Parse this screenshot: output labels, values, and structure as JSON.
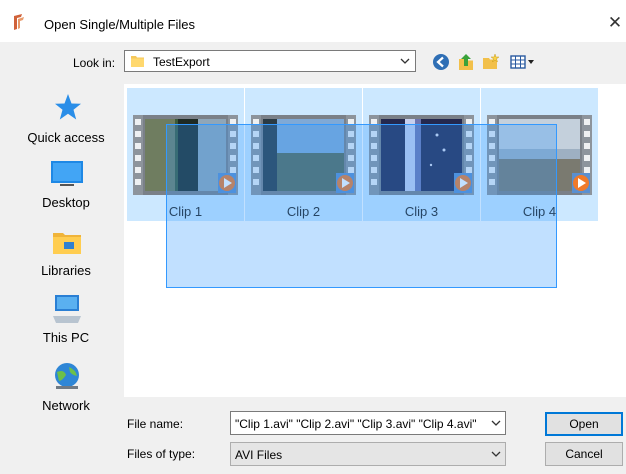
{
  "window": {
    "title": "Open Single/Multiple Files",
    "close_glyph": "✕"
  },
  "toolbar": {
    "look_in_label": "Look in:",
    "look_in_value": "TestExport",
    "icons": [
      "back-icon",
      "up-folder-icon",
      "new-folder-icon",
      "view-menu-icon"
    ]
  },
  "places": [
    {
      "label": "Quick access",
      "icon": "quick-access-star-icon"
    },
    {
      "label": "Desktop",
      "icon": "desktop-icon"
    },
    {
      "label": "Libraries",
      "icon": "libraries-icon"
    },
    {
      "label": "This PC",
      "icon": "this-pc-icon"
    },
    {
      "label": "Network",
      "icon": "network-icon"
    }
  ],
  "files": [
    {
      "name": "Clip 1",
      "selected": true
    },
    {
      "name": "Clip 2",
      "selected": true
    },
    {
      "name": "Clip 3",
      "selected": true
    },
    {
      "name": "Clip 4",
      "selected": true
    }
  ],
  "form": {
    "file_name_label": "File name:",
    "file_name_value": "\"Clip 1.avi\" \"Clip 2.avi\" \"Clip 3.avi\" \"Clip 4.avi\"",
    "file_type_label": "Files of type:",
    "file_type_value": "AVI Files"
  },
  "buttons": {
    "open": "Open",
    "cancel": "Cancel"
  },
  "colors": {
    "selection": "#cce8ff",
    "selection_border": "#3399ff",
    "default_button_border": "#0078d7"
  }
}
